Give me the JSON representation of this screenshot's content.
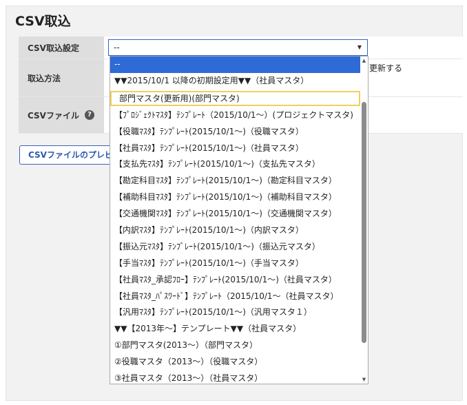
{
  "title": "CSV取込",
  "form": {
    "setting_label": "CSV取込設定",
    "method_label": "取込方法",
    "file_label": "CSVファイル",
    "help_glyph": "?",
    "method_text": "更新する"
  },
  "select": {
    "value": "--",
    "arrow": "▼"
  },
  "preview_button": "CSVファイルのプレビ",
  "dropdown": {
    "items": [
      "--",
      "▼▼2015/10/1 以降の初期設定用▼▼（社員マスタ）",
      "部門マスタ(更新用)(部門マスタ)",
      "【ﾌﾟﾛｼﾞｪｸﾄﾏｽﾀ】ﾃﾝﾌﾟﾚｰﾄ（2015/10/1～）(プロジェクトマスタ)",
      "【役職ﾏｽﾀ】ﾃﾝﾌﾟﾚｰﾄ(2015/10/1～)（役職マスタ）",
      "【社員ﾏｽﾀ】ﾃﾝﾌﾟﾚｰﾄ(2015/10/1～)（社員マスタ）",
      "【支払先ﾏｽﾀ】ﾃﾝﾌﾟﾚｰﾄ(2015/10/1～)（支払先マスタ）",
      "【勘定科目ﾏｽﾀ】ﾃﾝﾌﾟﾚｰﾄ(2015/10/1～)（勘定科目マスタ）",
      "【補助科目ﾏｽﾀ】ﾃﾝﾌﾟﾚｰﾄ(2015/10/1～)（補助科目マスタ）",
      "【交通機関ﾏｽﾀ】ﾃﾝﾌﾟﾚｰﾄ(2015/10/1～)（交通機関マスタ）",
      "【内訳ﾏｽﾀ】ﾃﾝﾌﾟﾚｰﾄ(2015/10/1～)（内訳マスタ）",
      "【振込元ﾏｽﾀ】ﾃﾝﾌﾟﾚｰﾄ(2015/10/1～)（振込元マスタ）",
      "【手当ﾏｽﾀ】ﾃﾝﾌﾟﾚｰﾄ(2015/10/1～)（手当マスタ）",
      "【社員ﾏｽﾀ_承認ﾌﾛｰ】ﾃﾝﾌﾟﾚｰﾄ(2015/10/1～)（社員マスタ）",
      "【社員ﾏｽﾀ_ﾊﾟｽﾜｰﾄﾞ】ﾃﾝﾌﾟﾚｰﾄ（2015/10/1～（社員マスタ）",
      "【汎用ﾏｽﾀ】ﾃﾝﾌﾟﾚｰﾄ(2015/10/1～)（汎用マスタ１）",
      "▼▼【2013年～】テンプレート▼▼（社員マスタ）",
      "①部門マスタ(2013～）（部門マスタ）",
      "②役職マスタ（2013～）（役職マスタ）",
      "③社員マスタ（2013～）（社員マスタ）"
    ],
    "selected_index": 0,
    "highlight_index": 2,
    "scroll_up": "▲",
    "scroll_down": "▼"
  }
}
